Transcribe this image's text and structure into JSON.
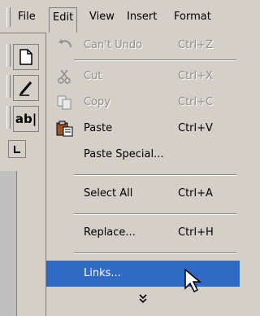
{
  "menubar": {
    "items": [
      {
        "label": "File"
      },
      {
        "label": "Edit"
      },
      {
        "label": "View"
      },
      {
        "label": "Insert"
      },
      {
        "label": "Format"
      }
    ]
  },
  "toolbar": {
    "new_icon": "new-document-icon",
    "draw_icon": "pencil-icon",
    "text_label": "ab|",
    "tab_icon": "tab-stop-icon"
  },
  "edit_menu": {
    "items": [
      {
        "label": "Can't Undo",
        "shortcut": "Ctrl+Z",
        "disabled": true,
        "icon": "undo-icon"
      },
      {
        "label": "Cut",
        "shortcut": "Ctrl+X",
        "disabled": true,
        "icon": "cut-icon"
      },
      {
        "label": "Copy",
        "shortcut": "Ctrl+C",
        "disabled": true,
        "icon": "copy-icon"
      },
      {
        "label": "Paste",
        "shortcut": "Ctrl+V",
        "disabled": false,
        "icon": "paste-icon"
      },
      {
        "label": "Paste Special...",
        "shortcut": "",
        "disabled": false
      },
      {
        "label": "Select All",
        "shortcut": "Ctrl+A",
        "disabled": false
      },
      {
        "label": "Replace...",
        "shortcut": "Ctrl+H",
        "disabled": false
      },
      {
        "label": "Links...",
        "shortcut": "",
        "disabled": false,
        "highlighted": true
      }
    ],
    "expand_glyph": "¥"
  }
}
